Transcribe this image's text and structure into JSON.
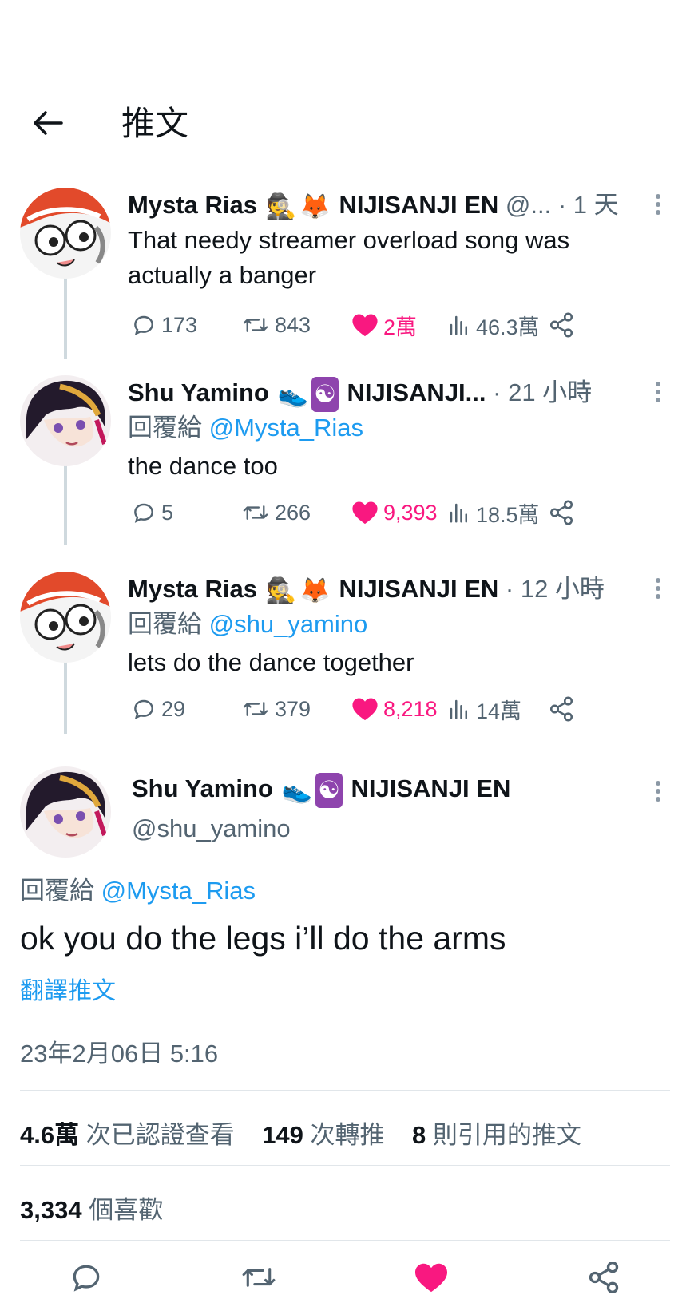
{
  "header": {
    "title": "推文"
  },
  "thread": [
    {
      "name": "Mysta Rias",
      "emoji1": "🕵",
      "emoji2": "🦊",
      "affiliation": "NIJISANJI EN",
      "handle_trunc": "@...",
      "time": "· 1 天",
      "reply_prefix": "",
      "reply_mention": "",
      "text": "That needy streamer overload song was actually a banger",
      "replies": "173",
      "retweets": "843",
      "likes": "2萬",
      "views": "46.3萬"
    },
    {
      "name": "Shu Yamino",
      "emoji1": "👟",
      "emoji2": "☯",
      "affiliation": "NIJISANJI...",
      "handle_trunc": "",
      "time": "· 21 小時",
      "reply_prefix": "回覆給",
      "reply_mention": "@Mysta_Rias",
      "text": "the dance too",
      "replies": "5",
      "retweets": "266",
      "likes": "9,393",
      "views": "18.5萬"
    },
    {
      "name": "Mysta Rias",
      "emoji1": "🕵",
      "emoji2": "🦊",
      "affiliation": "NIJISANJI EN",
      "handle_trunc": "",
      "time": "· 12 小時",
      "reply_prefix": "回覆給",
      "reply_mention": "@shu_yamino",
      "text": "lets do the dance together",
      "replies": "29",
      "retweets": "379",
      "likes": "8,218",
      "views": "14萬"
    }
  ],
  "main": {
    "name": "Shu Yamino",
    "emoji1": "👟",
    "emoji2": "☯",
    "affiliation": "NIJISANJI EN",
    "handle": "@shu_yamino",
    "reply_prefix": "回覆給",
    "reply_mention": "@Mysta_Rias",
    "text": "ok you do the legs i’ll do the arms",
    "translate": "翻譯推文",
    "timestamp": "23年2月06日 5:16",
    "views_count": "4.6萬",
    "views_label": "次已認證查看",
    "retweets_count": "149",
    "retweets_label": "次轉推",
    "quotes_count": "8",
    "quotes_label": "則引用的推文",
    "likes_count": "3,334",
    "likes_label": "個喜歡"
  },
  "colors": {
    "accent": "#1d9bf0",
    "like": "#f91880",
    "muted": "#536471",
    "text": "#0f1419"
  },
  "icons": [
    "back-arrow-icon",
    "more-icon",
    "reply-icon",
    "retweet-icon",
    "heart-icon",
    "views-icon",
    "share-icon"
  ]
}
